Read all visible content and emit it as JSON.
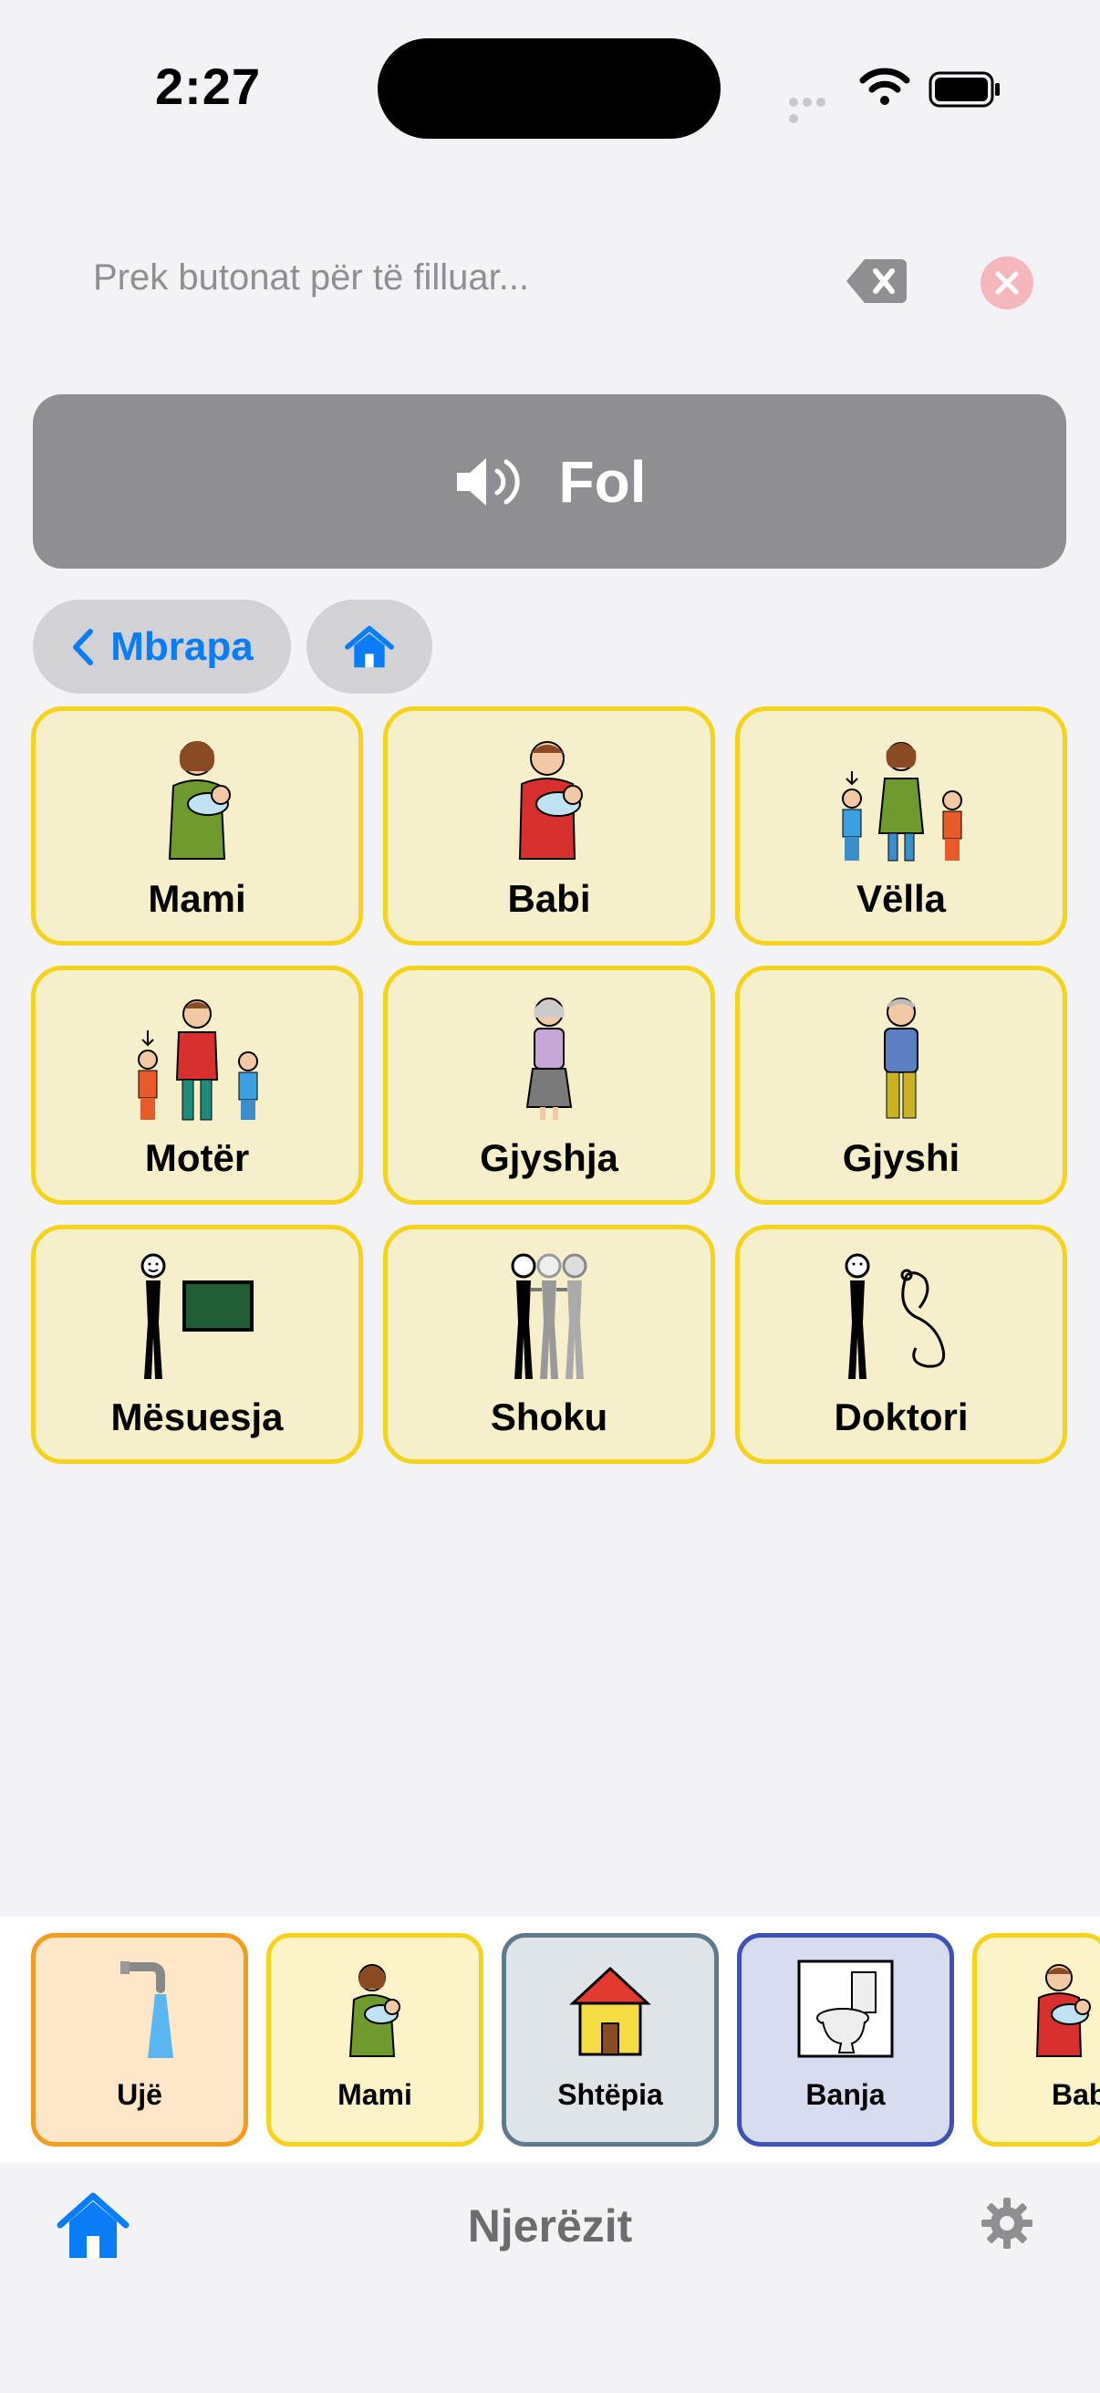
{
  "status": {
    "time": "2:27"
  },
  "input": {
    "placeholder": "Prek butonat për të filluar..."
  },
  "speak": {
    "label": "Fol"
  },
  "nav": {
    "back_label": "Mbrapa"
  },
  "grid": [
    {
      "label": "Mami",
      "icon": "mother-baby-icon"
    },
    {
      "label": "Babi",
      "icon": "father-baby-icon"
    },
    {
      "label": "Vëlla",
      "icon": "brother-icon"
    },
    {
      "label": "Motër",
      "icon": "sister-icon"
    },
    {
      "label": "Gjyshja",
      "icon": "grandmother-icon"
    },
    {
      "label": "Gjyshi",
      "icon": "grandfather-icon"
    },
    {
      "label": "Mësuesja",
      "icon": "teacher-icon"
    },
    {
      "label": "Shoku",
      "icon": "friends-icon"
    },
    {
      "label": "Doktori",
      "icon": "doctor-icon"
    }
  ],
  "strip": [
    {
      "label": "Ujë",
      "icon": "water-tap-icon"
    },
    {
      "label": "Mami",
      "icon": "mother-baby-icon"
    },
    {
      "label": "Shtëpia",
      "icon": "house-icon"
    },
    {
      "label": "Banja",
      "icon": "toilet-icon"
    },
    {
      "label": "Babi",
      "icon": "father-baby-icon"
    }
  ],
  "tabbar": {
    "title": "Njerëzit"
  },
  "colors": {
    "accent": "#0a7cf6",
    "tile_bg": "#f5efcb",
    "tile_border": "#f6d31b",
    "speak_bg": "#8e8e93",
    "clear": "#f5b7bd"
  }
}
